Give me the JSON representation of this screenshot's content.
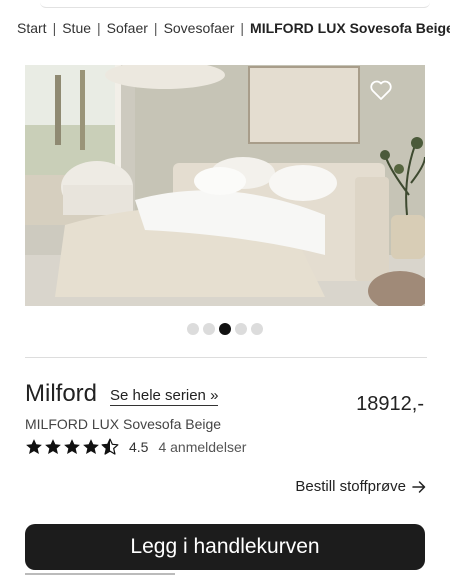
{
  "breadcrumb": {
    "items": [
      "Start",
      "Stue",
      "Sofaer",
      "Sovesofaer"
    ],
    "current": "MILFORD LUX Sovesofa Beige",
    "separator": "|"
  },
  "gallery": {
    "favorite_icon": "heart-icon",
    "image_count": 5,
    "active_index": 2
  },
  "product": {
    "name": "Milford",
    "series_link": "Se hele serien »",
    "subtitle": "MILFORD LUX Sovesofa Beige",
    "price": "18912,-",
    "rating_value": "4.5",
    "rating_stars": 4.5,
    "review_count": "4 anmeldelser"
  },
  "actions": {
    "fabric_sample": "Bestill stoffprøve",
    "fabric_sample_icon": "arrow-right-icon",
    "add_to_cart": "Legg i handlekurven"
  },
  "colors": {
    "button_bg": "#1c1c1c",
    "active_dot": "#111111",
    "inactive_dot": "#dcdcdc"
  }
}
